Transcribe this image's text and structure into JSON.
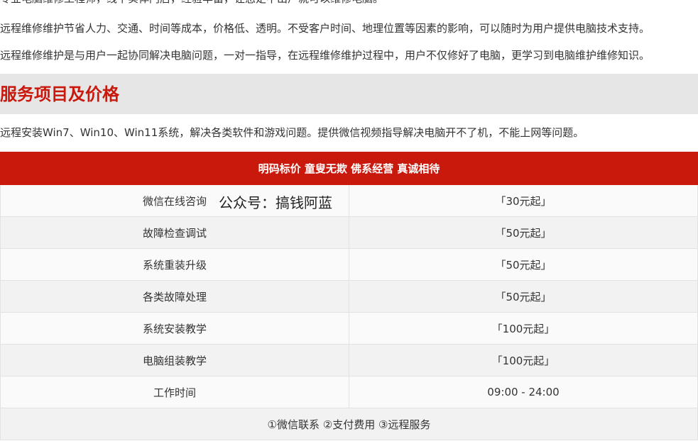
{
  "paragraphs": [
    "专业电脑维修工程师，线下实体门店，经验丰富，让您足不出户就可以维修电脑。",
    "远程维修维护节省人力、交通、时间等成本，价格低、透明。不受客户时间、地理位置等因素的影响，可以随时为用户提供电脑技术支持。",
    "远程维修维护是与用户一起协同解决电脑问题，一对一指导，在远程维修维护过程中，用户不仅修好了电脑，更学习到电脑维护维修知识。"
  ],
  "section": {
    "title": "服务项目及价格",
    "intro": "远程安装Win7、Win10、Win11系统，解决各类软件和游戏问题。提供微信视频指导解决电脑开不了机，不能上网等问题。"
  },
  "watermark": "公众号：搞钱阿蓝",
  "price_table": {
    "header": "明码标价 童叟无欺 佛系经营 真诚相待",
    "rows": [
      {
        "service": "微信在线咨询",
        "price": "「30元起」"
      },
      {
        "service": "故障检查调试",
        "price": "「50元起」"
      },
      {
        "service": "系统重装升级",
        "price": "「50元起」"
      },
      {
        "service": "各类故障处理",
        "price": "「50元起」"
      },
      {
        "service": "系统安装教学",
        "price": "「100元起」"
      },
      {
        "service": "电脑组装教学",
        "price": "「100元起」"
      },
      {
        "service": "工作时间",
        "price": "09:00 - 24:00"
      }
    ],
    "footer": "①微信联系 ②支付费用 ③远程服务"
  },
  "colors": {
    "accent_red": "#c9180c",
    "section_band": "#e6e6e6"
  }
}
